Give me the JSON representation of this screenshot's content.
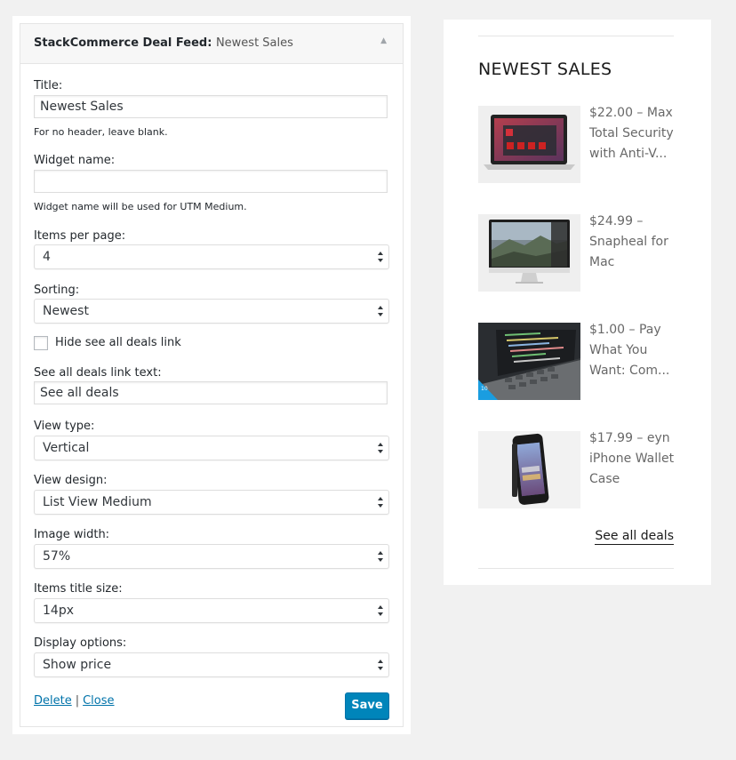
{
  "widget": {
    "plugin_name": "StackCommerce Deal Feed:",
    "instance_name": "Newest Sales",
    "fields": {
      "title": {
        "label": "Title:",
        "value": "Newest Sales",
        "desc": "For no header, leave blank."
      },
      "widget_name": {
        "label": "Widget name:",
        "value": "",
        "desc": "Widget name will be used for UTM Medium."
      },
      "items_per_page": {
        "label": "Items per page:",
        "selected": "4"
      },
      "sorting": {
        "label": "Sorting:",
        "selected": "Newest"
      },
      "hide_link": {
        "label": "Hide see all deals link",
        "checked": false
      },
      "link_text": {
        "label": "See all deals link text:",
        "value": "See all deals"
      },
      "view_type": {
        "label": "View type:",
        "selected": "Vertical"
      },
      "view_design": {
        "label": "View design:",
        "selected": "List View Medium"
      },
      "image_width": {
        "label": "Image width:",
        "selected": "57%"
      },
      "title_size": {
        "label": "Items title size:",
        "selected": "14px"
      },
      "display_options": {
        "label": "Display options:",
        "selected": "Show price"
      }
    },
    "actions": {
      "delete": "Delete",
      "separator": "|",
      "close": "Close",
      "save": "Save"
    }
  },
  "preview": {
    "title": "NEWEST SALES",
    "deals": [
      {
        "title": "$22.00 – Max Total Security with Anti-V...",
        "thumb": "laptop-security-icon"
      },
      {
        "title": "$24.99 – Snapheal for Mac",
        "thumb": "imac-landscape-icon"
      },
      {
        "title": "$1.00 – Pay What You Want: Com...",
        "thumb": "code-laptop-icon"
      },
      {
        "title": "$17.99 – eyn iPhone Wallet Case",
        "thumb": "iphone-case-icon"
      }
    ],
    "see_all": "See all deals"
  },
  "colors": {
    "primary_button": "#0085ba",
    "link": "#0073aa",
    "page_bg": "#f1f1f1"
  }
}
